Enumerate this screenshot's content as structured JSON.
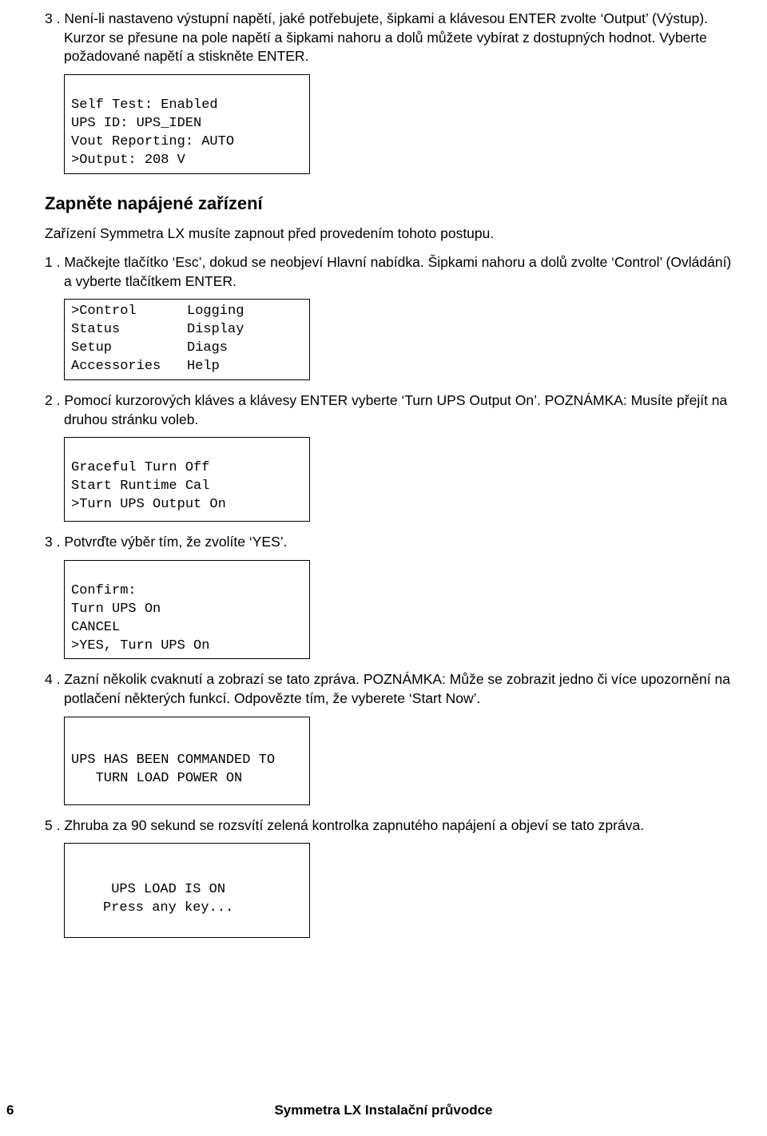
{
  "step3": {
    "num": "3 .",
    "text": "Není-li nastaveno výstupní napětí, jaké potřebujete, šipkami a klávesou ENTER zvolte ‘Output’ (Výstup). Kurzor se přesune na pole napětí a šipkami nahoru a dolů můžete vybírat z dostupných hodnot. Vyberte požadované napětí a stiskněte ENTER."
  },
  "display1": {
    "l1": "Self Test: Enabled",
    "l2": "UPS ID: UPS_IDEN",
    "l3": "Vout Reporting: AUTO",
    "l4": ">Output: 208 V"
  },
  "heading": "Zapněte napájené zařízení",
  "prestep": "Zařízení Symmetra LX musíte zapnout před provedením tohoto postupu.",
  "p1": {
    "num": "1 .",
    "text": "Mačkejte tlačítko ‘Esc’, dokud se neobjeví Hlavní nabídka. Šipkami nahoru a dolů zvolte ‘Control’ (Ovládání) a vyberte tlačítkem ENTER."
  },
  "display2": {
    "c1l1": ">Control",
    "c1l2": "Status",
    "c1l3": "Setup",
    "c1l4": "Accessories",
    "c2l1": "Logging",
    "c2l2": "Display",
    "c2l3": "Diags",
    "c2l4": "Help"
  },
  "p2": {
    "num": "2 .",
    "text": "Pomocí kurzorových kláves a klávesy ENTER vyberte ‘Turn UPS Output On’. POZNÁMKA: Musíte přejít na druhou stránku voleb."
  },
  "display3": {
    "l1": "Graceful Turn Off",
    "l2": "Start Runtime Cal",
    "l3": ">Turn UPS Output On"
  },
  "p3": {
    "num": "3 .",
    "text": "Potvrďte výběr tím, že zvolíte ‘YES’."
  },
  "display4": {
    "l1": "Confirm:",
    "l2": "Turn UPS On",
    "l3": "CANCEL",
    "l4": ">YES, Turn UPS On"
  },
  "p4": {
    "num": "4 .",
    "text": "Zazní několik cvaknutí a zobrazí se tato zpráva. POZNÁMKA: Může se zobrazit jedno či více upozornění na potlačení některých funkcí. Odpovězte tím, že vyberete ‘Start Now’."
  },
  "display5": {
    "l1": "UPS HAS BEEN COMMANDED TO",
    "l2": "   TURN LOAD POWER ON"
  },
  "p5": {
    "num": "5 .",
    "text": "Zhruba za 90 sekund se rozsvítí zelená kontrolka zapnutého napájení a objeví se tato zpráva."
  },
  "display6": {
    "l1": " UPS LOAD IS ON",
    "l2": "Press any key..."
  },
  "footer": "Symmetra LX Instalační průvodce",
  "page": "6"
}
